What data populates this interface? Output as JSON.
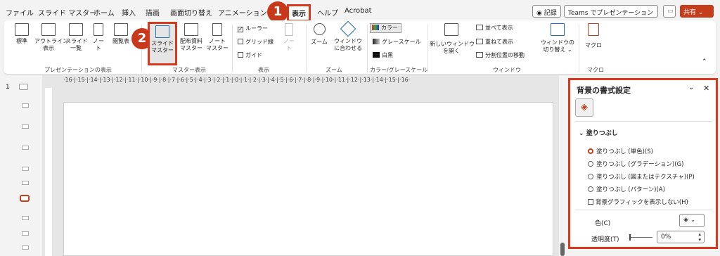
{
  "tabs": [
    "ファイル",
    "スライド マスター",
    "ホーム",
    "挿入",
    "描画",
    "画面切り替え",
    "アニメーション",
    "表示",
    "ヘルプ",
    "Acrobat"
  ],
  "active_tab": "表示",
  "right_buttons": {
    "record": "◉ 記録",
    "teams": "Teams でプレゼンテーション",
    "share": "共有"
  },
  "step_badges": [
    "1",
    "2"
  ],
  "ribbon": {
    "pres_views": {
      "label": "プレゼンテーションの表示",
      "items": [
        "標準",
        "アウトライン\n表示",
        "スライド\n一覧",
        "ノー\nト",
        "閲覧表"
      ]
    },
    "master_views": {
      "label": "マスター表示",
      "items": [
        "スライド\nマスター",
        "配布資料\nマスター",
        "ノート\nマスター"
      ]
    },
    "show": {
      "label": "表示",
      "ruler": "ルーラー",
      "grid": "グリッド線",
      "guide": "ガイド",
      "notes": "ノー\nト"
    },
    "zoom": {
      "label": "ズーム",
      "zoom": "ズーム",
      "fit": "ウィンドウ\nに合わせる"
    },
    "color": {
      "label": "カラー/グレースケール",
      "color": "カラー",
      "gray": "グレースケール",
      "bw": "白黒"
    },
    "window": {
      "label": "ウィンドウ",
      "new": "新しいウィンドウ\nを開く",
      "arrange": "並べて表示",
      "cascade": "重ねて表示",
      "move": "分割位置の移動"
    },
    "switch": "ウィンドウの\n切り替え ⌄",
    "macro": {
      "label": "マクロ",
      "item": "マクロ"
    }
  },
  "ruler_text": "·16·|·15·|·14·|·13·|·12·|·11·|·10·|·9·|·8·|·7·|·6·|·5·|·4·|·3·|·2·|·1·|·0·|·1·|·2·|·3·|·4·|·5·|·6·|·7·|·8·|·9·|·10·|·11·|·12·|·13·|·14·|·15·|·16·",
  "slide_number": "1",
  "panel": {
    "title": "背景の書式設定",
    "section": "塗りつぶし",
    "options": [
      "塗りつぶし (単色)(S)",
      "塗りつぶし (グラデーション)(G)",
      "塗りつぶし (図またはテクスチャ)(P)",
      "塗りつぶし (パターン)(A)"
    ],
    "hide_graphics": "背景グラフィックを表示しない(H)",
    "color_label": "色(C)",
    "transparency_label": "透明度(T)",
    "transparency_value": "0%"
  }
}
